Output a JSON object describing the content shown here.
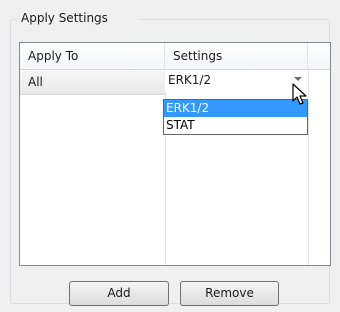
{
  "panel": {
    "title": "Apply Settings"
  },
  "grid": {
    "columns": [
      "Apply To",
      "Settings"
    ],
    "rows": [
      {
        "apply_to": "All",
        "settings": "ERK1/2"
      }
    ]
  },
  "dropdown": {
    "options": [
      "ERK1/2",
      "STAT"
    ],
    "selected": "ERK1/2",
    "highlight_color": "#3399ff"
  },
  "buttons": {
    "add_label": "Add",
    "remove_label": "Remove"
  },
  "icons": {
    "combo_arrow": "chevron-down-icon",
    "cursor": "mouse-cursor-icon"
  }
}
